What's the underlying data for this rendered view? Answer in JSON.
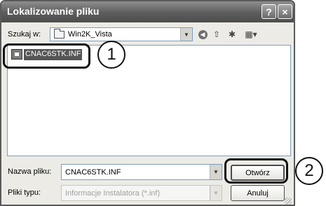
{
  "window": {
    "title": "Lokalizowanie pliku",
    "help_glyph": "?",
    "close_glyph": "×"
  },
  "toolbar": {
    "lookin_label": "Szukaj w:",
    "lookin_value": "Win2K_Vista",
    "back_icon": "back-arrow-icon",
    "up_icon": "up-folder-icon",
    "newfolder_icon": "new-folder-icon",
    "views_icon": "views-menu-icon"
  },
  "filelist": {
    "items": [
      {
        "name": "CNAC6STK.INF",
        "selected": true
      }
    ]
  },
  "form": {
    "filename_label": "Nazwa pliku:",
    "filename_value": "CNAC6STK.INF",
    "filetype_label": "Pliki typu:",
    "filetype_value": "Informacje Instalatora (*.inf)"
  },
  "buttons": {
    "open": "Otwórz",
    "cancel": "Anuluj"
  },
  "callouts": {
    "one": "1",
    "two": "2"
  },
  "colors": {
    "titlebar": "#5c5c5c",
    "selection": "#555555",
    "dialog_bg": "#ecebe6"
  }
}
